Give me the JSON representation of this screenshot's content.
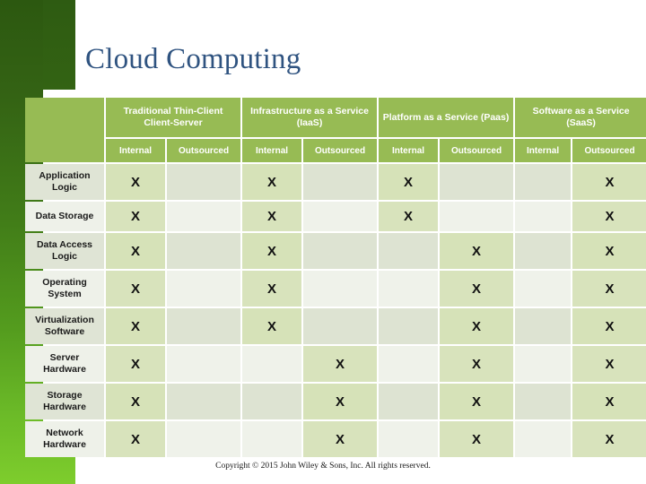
{
  "slide": {
    "title": "Cloud Computing",
    "footer": "Copyright © 2015 John Wiley & Sons, Inc. All rights reserved.",
    "accent_green_dark": "#2c5810",
    "accent_green_light": "#7ecd2d",
    "title_color": "#2f5380",
    "header_fill": "#97bb54",
    "cell_on_fill": "#d6e2b8",
    "cell_off_fill": "#dde3d2"
  },
  "table": {
    "corner_label": "",
    "mark": "X",
    "column_groups": [
      {
        "label": "Traditional Thin-Client Client-Server",
        "sub": [
          "Internal",
          "Outsourced"
        ]
      },
      {
        "label": "Infrastructure as a Service (IaaS)",
        "sub": [
          "Internal",
          "Outsourced"
        ]
      },
      {
        "label": "Platform as a Service (Paas)",
        "sub": [
          "Internal",
          "Outsourced"
        ]
      },
      {
        "label": "Software as a Service (SaaS)",
        "sub": [
          "Internal",
          "Outsourced"
        ]
      }
    ],
    "rows": [
      {
        "label": "Application Logic",
        "marks": [
          true,
          false,
          true,
          false,
          true,
          false,
          false,
          true
        ]
      },
      {
        "label": "Data Storage",
        "marks": [
          true,
          false,
          true,
          false,
          true,
          false,
          false,
          true
        ]
      },
      {
        "label": "Data Access Logic",
        "marks": [
          true,
          false,
          true,
          false,
          false,
          true,
          false,
          true
        ]
      },
      {
        "label": "Operating System",
        "marks": [
          true,
          false,
          true,
          false,
          false,
          true,
          false,
          true
        ]
      },
      {
        "label": "Virtualization Software",
        "marks": [
          true,
          false,
          true,
          false,
          false,
          true,
          false,
          true
        ]
      },
      {
        "label": "Server Hardware",
        "marks": [
          true,
          false,
          false,
          true,
          false,
          true,
          false,
          true
        ]
      },
      {
        "label": "Storage Hardware",
        "marks": [
          true,
          false,
          false,
          true,
          false,
          true,
          false,
          true
        ]
      },
      {
        "label": "Network Hardware",
        "marks": [
          true,
          false,
          false,
          true,
          false,
          true,
          false,
          true
        ]
      }
    ]
  }
}
